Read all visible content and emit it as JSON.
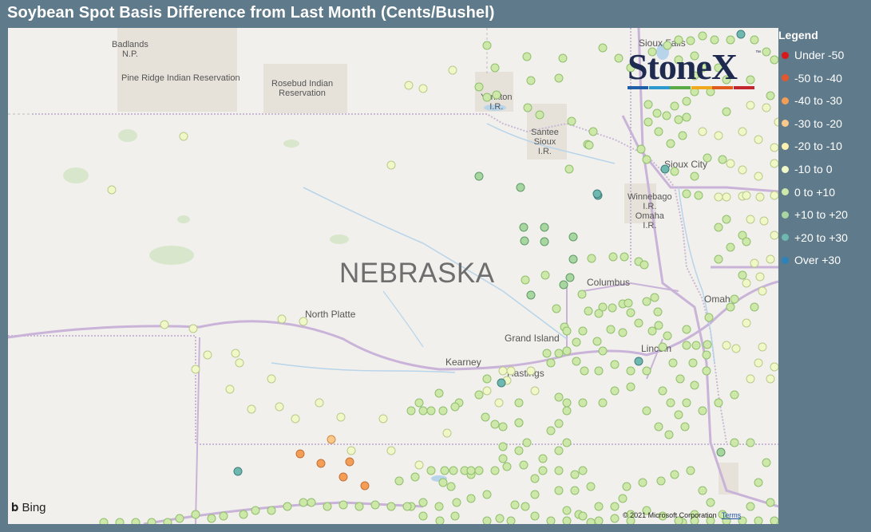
{
  "title": "Soybean Spot Basis Difference from Last Month (Cents/Bushel)",
  "map": {
    "state_label": "NEBRASKA",
    "labels": [
      {
        "id": "badlands",
        "text": "Badlands\nN.P."
      },
      {
        "id": "pine-ridge",
        "text": "Pine Ridge Indian Reservation"
      },
      {
        "id": "rosebud",
        "text": "Rosebud Indian\nReservation"
      },
      {
        "id": "yankton",
        "text": "Yankton\nI.R."
      },
      {
        "id": "santee",
        "text": "Santee\nSioux\nI.R."
      },
      {
        "id": "winnebago",
        "text": "Winnebago\nI.R.\nOmaha\nI.R."
      }
    ],
    "cities": [
      {
        "id": "north-platte",
        "text": "North Platte"
      },
      {
        "id": "grand-island",
        "text": "Grand Island"
      },
      {
        "id": "kearney",
        "text": "Kearney"
      },
      {
        "id": "hastings",
        "text": "Hastings"
      },
      {
        "id": "columbus",
        "text": "Columbus"
      },
      {
        "id": "omaha",
        "text": "Omaha"
      },
      {
        "id": "lincoln",
        "text": "Lincoln"
      },
      {
        "id": "sioux-city",
        "text": "Sioux City"
      },
      {
        "id": "sioux-falls",
        "text": "Sioux Falls"
      }
    ],
    "provider": "Bing",
    "copyright": "© 2021 Microsoft Corporation",
    "terms": "Terms"
  },
  "logo": {
    "text": "StoneX",
    "trademark": "™",
    "bar_colors": [
      "#1f5fa8",
      "#2e9ad0",
      "#5aab46",
      "#f0a81c",
      "#e05a1e",
      "#c4262e"
    ]
  },
  "legend": {
    "title": "Legend",
    "items": [
      {
        "label": "Under -50",
        "color": "#d7191c"
      },
      {
        "label": "-50 to -40",
        "color": "#e4572e"
      },
      {
        "label": "-40 to -30",
        "color": "#f39d55"
      },
      {
        "label": "-30 to -20",
        "color": "#f8c98b"
      },
      {
        "label": "-20 to -10",
        "color": "#fbf0b0"
      },
      {
        "label": "-10 to 0",
        "color": "#f0f8c8"
      },
      {
        "label": "0 to +10",
        "color": "#cde8a8"
      },
      {
        "label": "+10 to +20",
        "color": "#a8d6a0"
      },
      {
        "label": "+20 to +30",
        "color": "#6fb8b0"
      },
      {
        "label": "Over +30",
        "color": "#2b83ba"
      }
    ]
  }
}
